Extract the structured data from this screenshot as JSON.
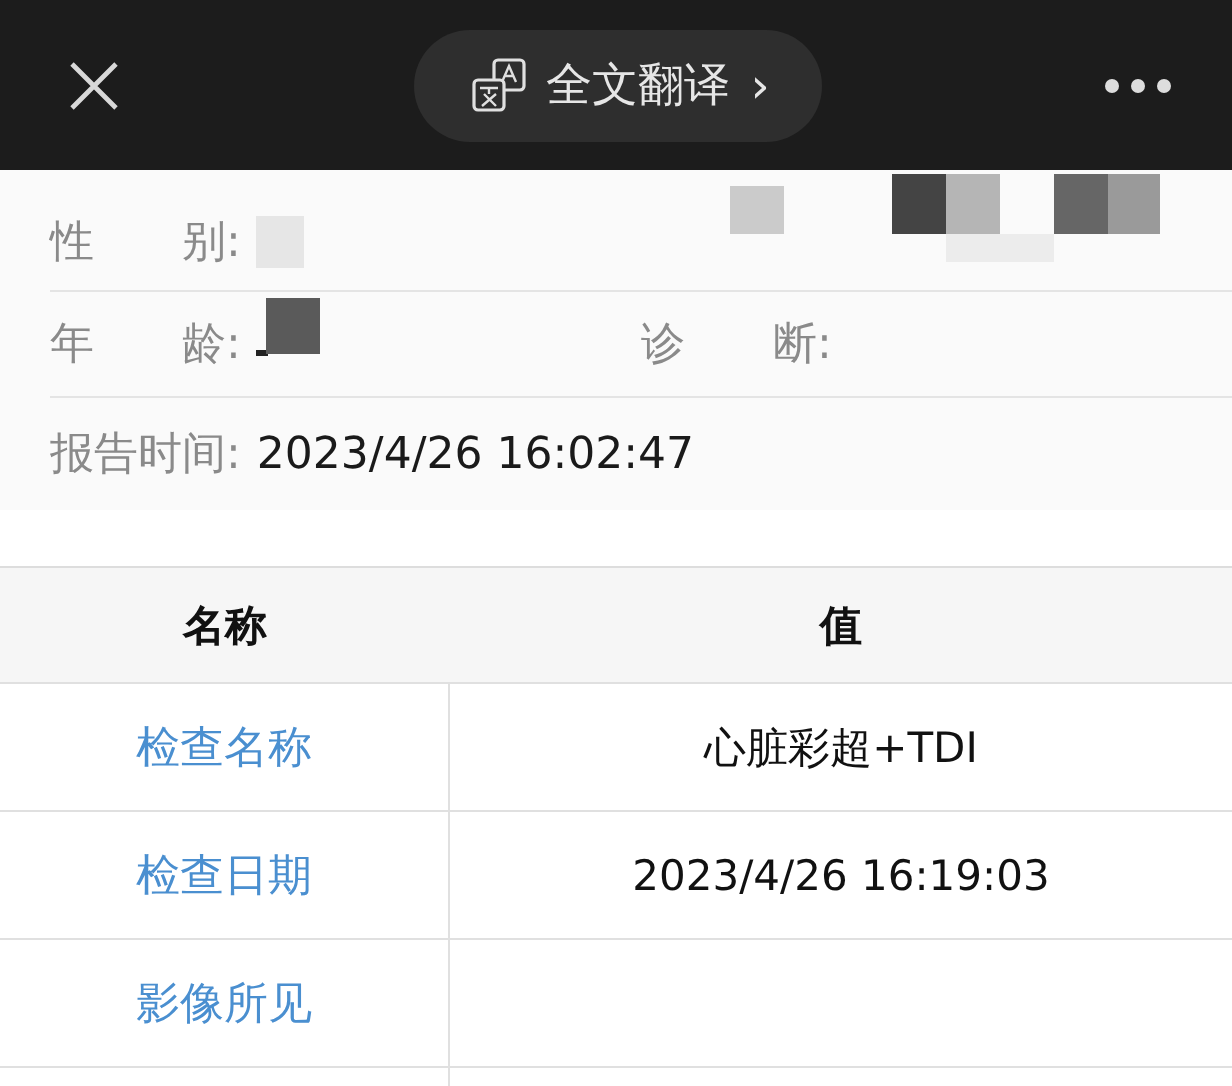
{
  "top_bar": {
    "translate_button": {
      "label": "全文翻译",
      "chevron": "›"
    }
  },
  "info": {
    "rows": [
      {
        "kind": "pair",
        "fields": [
          {
            "label": "性　　别:",
            "redacted": true
          }
        ]
      },
      {
        "kind": "pair",
        "fields": [
          {
            "label": "年　　龄:",
            "redacted": true
          },
          {
            "label": "诊　　断:"
          }
        ]
      },
      {
        "kind": "single",
        "fields": [
          {
            "label": "报告时间:",
            "value": "2023/4/26 16:02:47"
          }
        ]
      }
    ]
  },
  "table": {
    "columns": [
      "名称",
      "值"
    ],
    "rows": [
      {
        "name": "检查名称",
        "value": "心脏彩超+TDI"
      },
      {
        "name": "检查日期",
        "value": "2023/4/26 16:19:03"
      },
      {
        "name": "影像所见"
      }
    ]
  }
}
